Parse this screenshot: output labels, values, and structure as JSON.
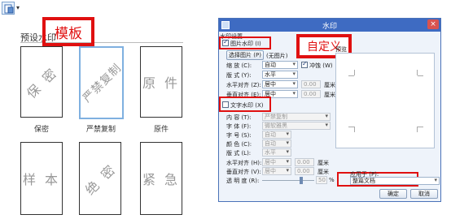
{
  "toolbar": {
    "watermark_icon": "watermark-icon",
    "dropdown_arrow": "▾"
  },
  "left_panel": {
    "section_label": "预设水印",
    "annotation": "模板",
    "cards": [
      {
        "watermark": "保 密",
        "caption": "保密"
      },
      {
        "watermark": "严禁复制",
        "caption": "严禁复制"
      },
      {
        "watermark": "原 件",
        "caption": "原件"
      },
      {
        "watermark": "样 本",
        "caption": ""
      },
      {
        "watermark": "绝 密",
        "caption": ""
      },
      {
        "watermark": "紧 急",
        "caption": ""
      }
    ]
  },
  "dialog": {
    "title": "水印",
    "close_icon": "×",
    "group_label": "水印设置",
    "picture_watermark": {
      "label": "图片水印 (I)",
      "checked": true,
      "select_button": "选择图片 (P)",
      "no_picture": "(无图片)",
      "scale_label": "缩 放 (C):",
      "scale_value": "自动",
      "washout_label": "冲蚀 (W)",
      "washout_checked": true,
      "layout_label": "版 式 (Y):",
      "layout_value": "水平",
      "halign_label": "水平对齐 (Z):",
      "halign_value": "居中",
      "halign_offset": "0.00",
      "halign_unit": "厘米",
      "valign_label": "垂直对齐 (E):",
      "valign_value": "居中",
      "valign_offset": "0.00",
      "valign_unit": "厘米"
    },
    "annotation": "自定义",
    "preview_label": "预览",
    "text_watermark": {
      "label": "文字水印 (X)",
      "checked": false,
      "content_label": "内 容 (T):",
      "content_value": "严禁复制",
      "font_label": "字 体 (F):",
      "font_value": "微软雅黑",
      "size_label": "字 号 (S):",
      "size_value": "自动",
      "color_label": "颜 色 (C):",
      "color_value": "自动",
      "layout_label": "版 式 (L):",
      "layout_value": "水平",
      "halign_label": "水平对齐 (H):",
      "halign_value": "居中",
      "halign_offset": "0.00",
      "halign_unit": "厘米",
      "valign_label": "垂直对齐 (V):",
      "valign_value": "居中",
      "valign_offset": "0.00",
      "valign_unit": "厘米",
      "transparency_label": "透 明 度 (R):",
      "transparency_value": "50",
      "transparency_unit": "%"
    },
    "apply_to_label": "应用于 (P):",
    "apply_to_value": "整篇文档",
    "ok_button": "确定",
    "cancel_button": "取消"
  },
  "colors": {
    "annotation_red": "#e01010",
    "title_bar": "#3e6bc2",
    "dialog_bg": "#eef3fa"
  }
}
